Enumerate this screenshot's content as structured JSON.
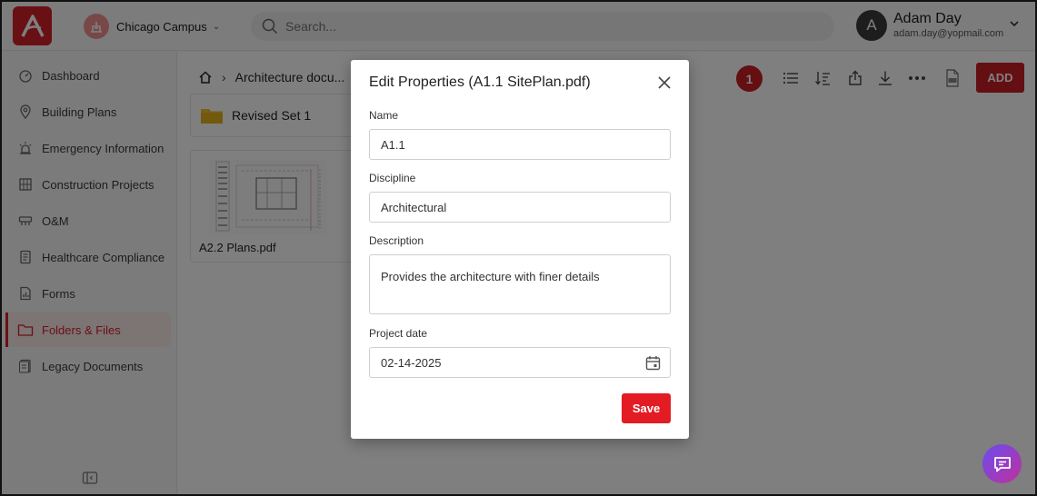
{
  "header": {
    "campus_label": "Chicago Campus",
    "search_placeholder": "Search...",
    "user": {
      "initial": "A",
      "name": "Adam Day",
      "email": "adam.day@yopmail.com"
    }
  },
  "sidebar": {
    "items": [
      {
        "label": "Dashboard",
        "icon": "dashboard-icon"
      },
      {
        "label": "Building Plans",
        "icon": "map-pin-icon"
      },
      {
        "label": "Emergency Information",
        "icon": "alarm-icon"
      },
      {
        "label": "Construction Projects",
        "icon": "building-icon"
      },
      {
        "label": "O&M",
        "icon": "tools-icon"
      },
      {
        "label": "Healthcare Compliance",
        "icon": "clipboard-icon"
      },
      {
        "label": "Forms",
        "icon": "form-icon"
      },
      {
        "label": "Folders & Files",
        "icon": "folder-icon",
        "active": true
      },
      {
        "label": "Legacy Documents",
        "icon": "document-icon"
      }
    ]
  },
  "main": {
    "breadcrumb": "Architecture docu...",
    "folder_name": "Revised Set 1",
    "file_name": "A2.2 Plans.pdf",
    "badge_count": "1",
    "add_label": "ADD"
  },
  "modal": {
    "title": "Edit Properties (A1.1 SitePlan.pdf)",
    "name_label": "Name",
    "name_value": "A1.1",
    "discipline_label": "Discipline",
    "discipline_value": "Architectural",
    "description_label": "Description",
    "description_value": "Provides the architecture with finer details",
    "project_date_label": "Project date",
    "project_date_value": "02-14-2025",
    "save_label": "Save"
  },
  "colors": {
    "brand": "#d3212b",
    "save": "#e31b23"
  }
}
